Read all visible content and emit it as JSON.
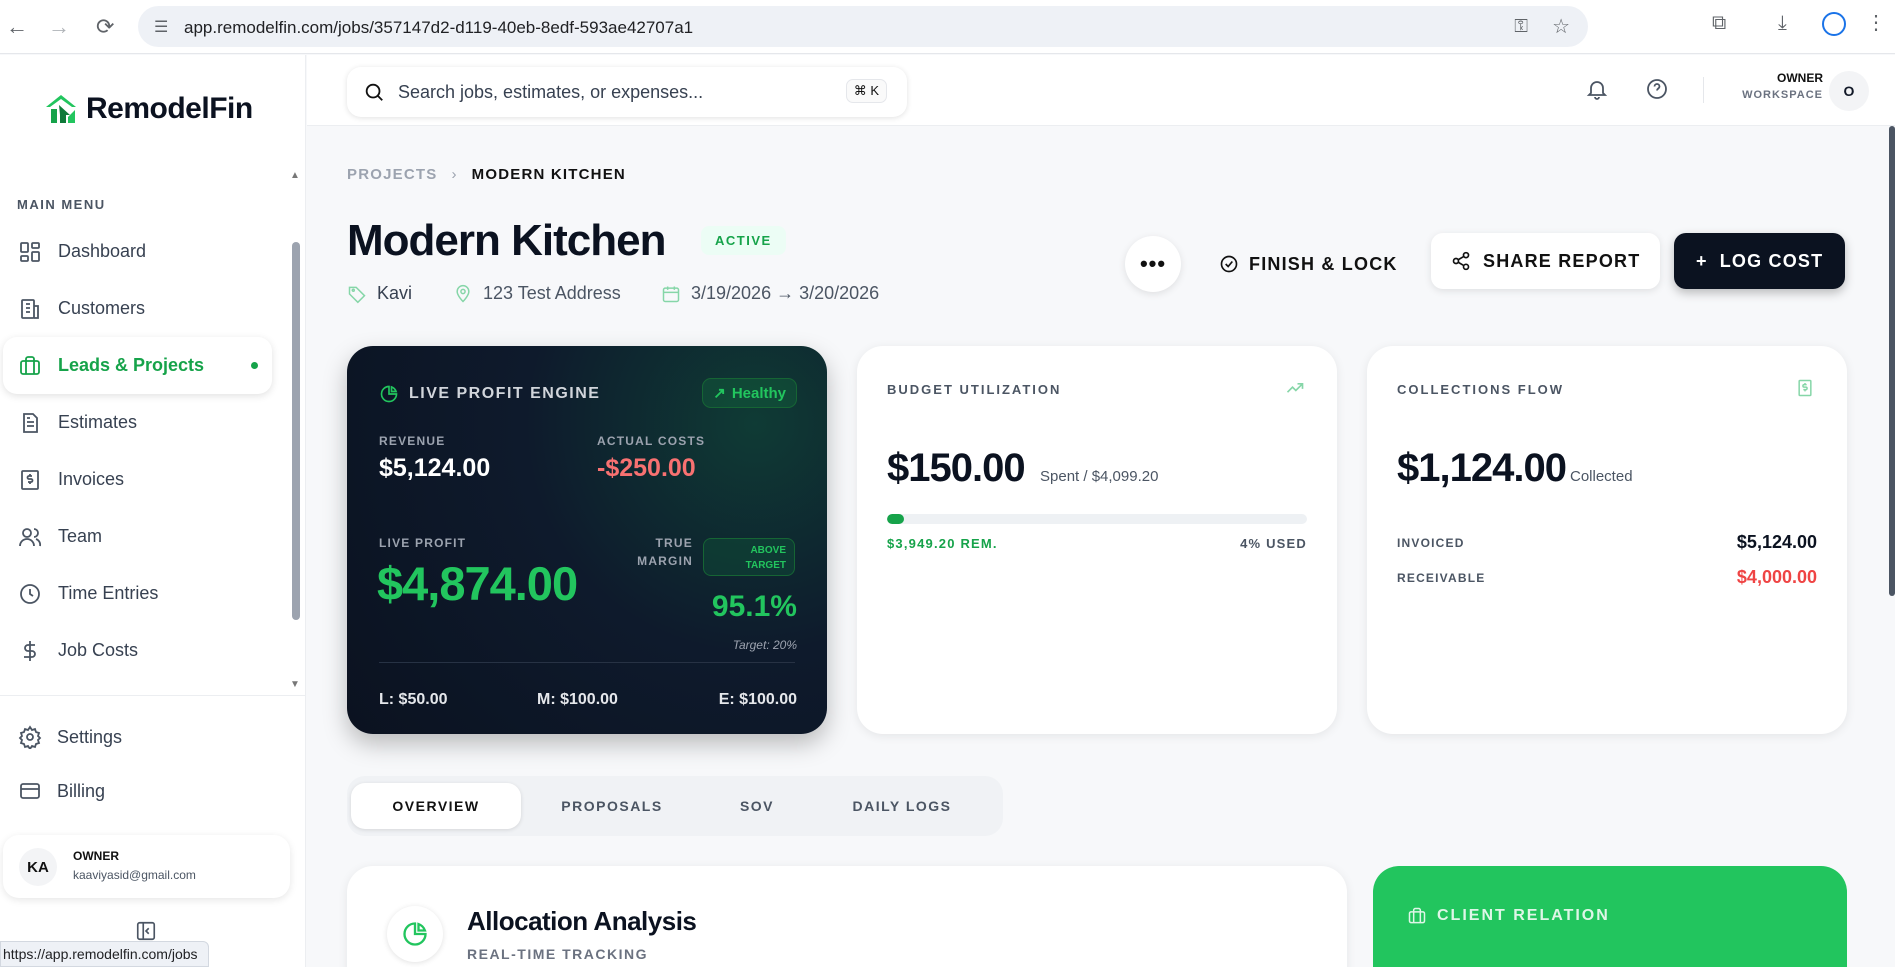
{
  "browser": {
    "url": "app.remodelfin.com/jobs/357147d2-d119-40eb-8edf-593ae42707a1",
    "status_url": "https://app.remodelfin.com/jobs"
  },
  "sidebar": {
    "brand": "RemodelFin",
    "menu_title": "MAIN MENU",
    "items": [
      {
        "label": "Dashboard",
        "icon": "dashboard-icon"
      },
      {
        "label": "Customers",
        "icon": "building-icon"
      },
      {
        "label": "Leads & Projects",
        "icon": "briefcase-icon",
        "active": true
      },
      {
        "label": "Estimates",
        "icon": "document-icon"
      },
      {
        "label": "Invoices",
        "icon": "invoice-icon"
      },
      {
        "label": "Team",
        "icon": "users-icon"
      },
      {
        "label": "Time Entries",
        "icon": "clock-icon"
      },
      {
        "label": "Job Costs",
        "icon": "dollar-icon"
      }
    ],
    "settings": "Settings",
    "billing": "Billing",
    "user": {
      "initials": "KA",
      "role": "OWNER",
      "email": "kaaviyasid@gmail.com"
    }
  },
  "header": {
    "search_placeholder": "Search jobs, estimates, or expenses...",
    "shortcut": "⌘ K",
    "workspace_owner": "OWNER",
    "workspace_label": "WORKSPACE",
    "workspace_initial": "O"
  },
  "project": {
    "breadcrumb_parent": "PROJECTS",
    "breadcrumb_current": "MODERN KITCHEN",
    "title": "Modern Kitchen",
    "status": "ACTIVE",
    "client": "Kavi",
    "address": "123 Test Address",
    "dates": "3/19/2026 → 3/20/2026",
    "more_label": "•••",
    "finish_label": "FINISH & LOCK",
    "share_label": "SHARE REPORT",
    "log_label": "LOG COST"
  },
  "profit_engine": {
    "title": "LIVE PROFIT ENGINE",
    "health": "Healthy",
    "revenue_label": "REVENUE",
    "revenue": "$5,124.00",
    "costs_label": "ACTUAL COSTS",
    "costs": "-$250.00",
    "live_label": "LIVE PROFIT",
    "live_profit": "$4,874.00",
    "margin_label_1": "TRUE",
    "margin_label_2": "MARGIN",
    "above_1": "ABOVE",
    "above_2": "TARGET",
    "margin": "95.1%",
    "target": "Target: 20%",
    "labor": "L: $50.00",
    "materials": "M: $100.00",
    "equipment": "E: $100.00"
  },
  "budget": {
    "title": "BUDGET UTILIZATION",
    "spent": "$150.00",
    "of_total": "Spent / $4,099.20",
    "remaining": "$3,949.20 REM.",
    "used": "4% USED",
    "used_fraction": 0.04
  },
  "collections": {
    "title": "COLLECTIONS FLOW",
    "collected": "$1,124.00",
    "collected_label": "Collected",
    "invoiced_label": "INVOICED",
    "invoiced": "$5,124.00",
    "receivable_label": "RECEIVABLE",
    "receivable": "$4,000.00"
  },
  "tabs": [
    "OVERVIEW",
    "PROPOSALS",
    "SOV",
    "DAILY LOGS"
  ],
  "allocation": {
    "title": "Allocation Analysis",
    "subtitle": "REAL-TIME TRACKING"
  },
  "client_relation": {
    "title": "CLIENT RELATION"
  },
  "colors": {
    "brand_green": "#16a34a",
    "dark": "#0b1220",
    "negative": "#ef4444"
  }
}
